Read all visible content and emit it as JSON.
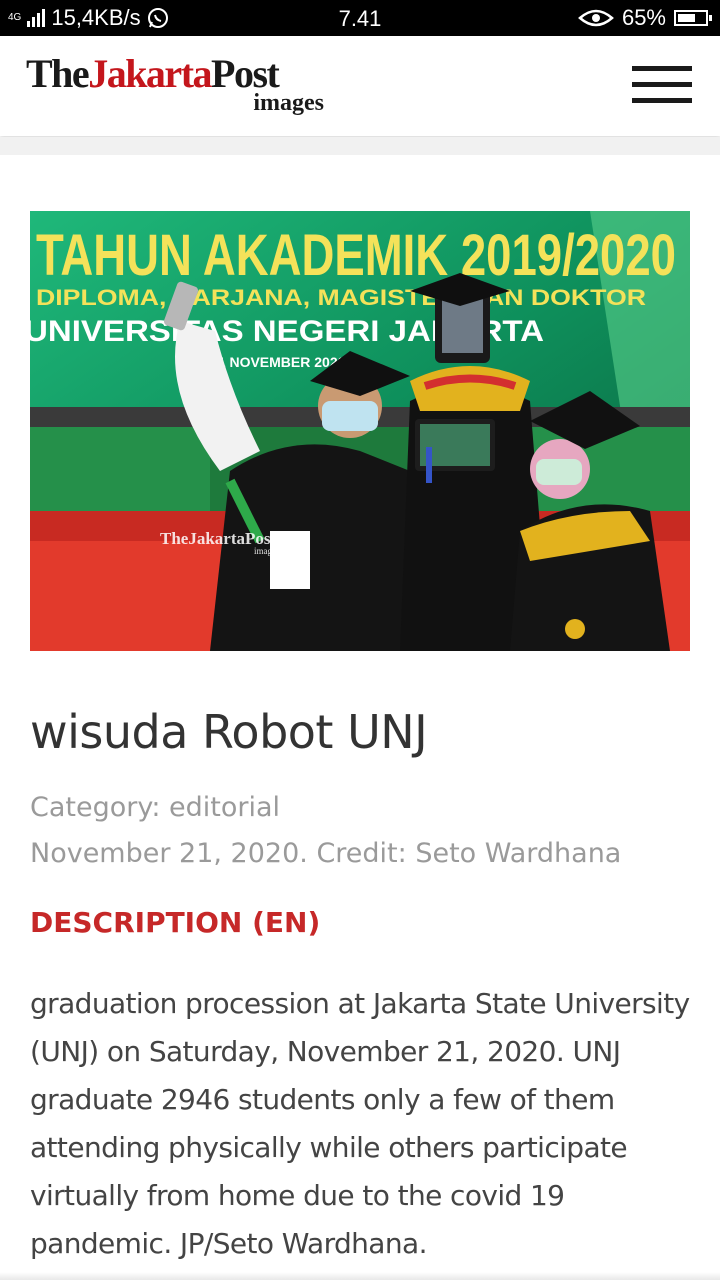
{
  "status_bar": {
    "network_type": "4G",
    "speed": "15,4KB/s",
    "time": "7.41",
    "battery_percent": "65%",
    "battery_level": 0.65,
    "icons": [
      "signal-icon",
      "whatsapp-icon",
      "eye-icon",
      "battery-icon"
    ]
  },
  "header": {
    "logo_text_the": "The",
    "logo_text_jakarta": "Jakarta",
    "logo_text_post": "Post",
    "logo_sub": "images",
    "menu_icon": "hamburger-menu-icon",
    "brand_red": "#c4161c"
  },
  "photo": {
    "banner_title": "TAHUN AKADEMIK 2019/2020",
    "banner_line2": "DIPLOMA, SARJANA, MAGISTER DAN DOKTOR",
    "banner_line3": "UNIVERSITAS NEGERI JAKARTA",
    "banner_line4": "21 NOVEMBER 2020",
    "watermark": "TheJakartaPost",
    "watermark_sub": "images"
  },
  "article": {
    "title": "wisuda Robot UNJ",
    "category": "Category: editorial",
    "date_credit": "November 21, 2020. Credit: Seto Wardhana",
    "description_heading": "DESCRIPTION (EN)",
    "description": "graduation procession at Jakarta State University (UNJ) on Saturday, November 21, 2020. UNJ graduate 2946 students only a few of them attending physically while others participate virtually from home due to the covid 19 pandemic. JP/Seto Wardhana.",
    "heading_color": "#c62828"
  }
}
